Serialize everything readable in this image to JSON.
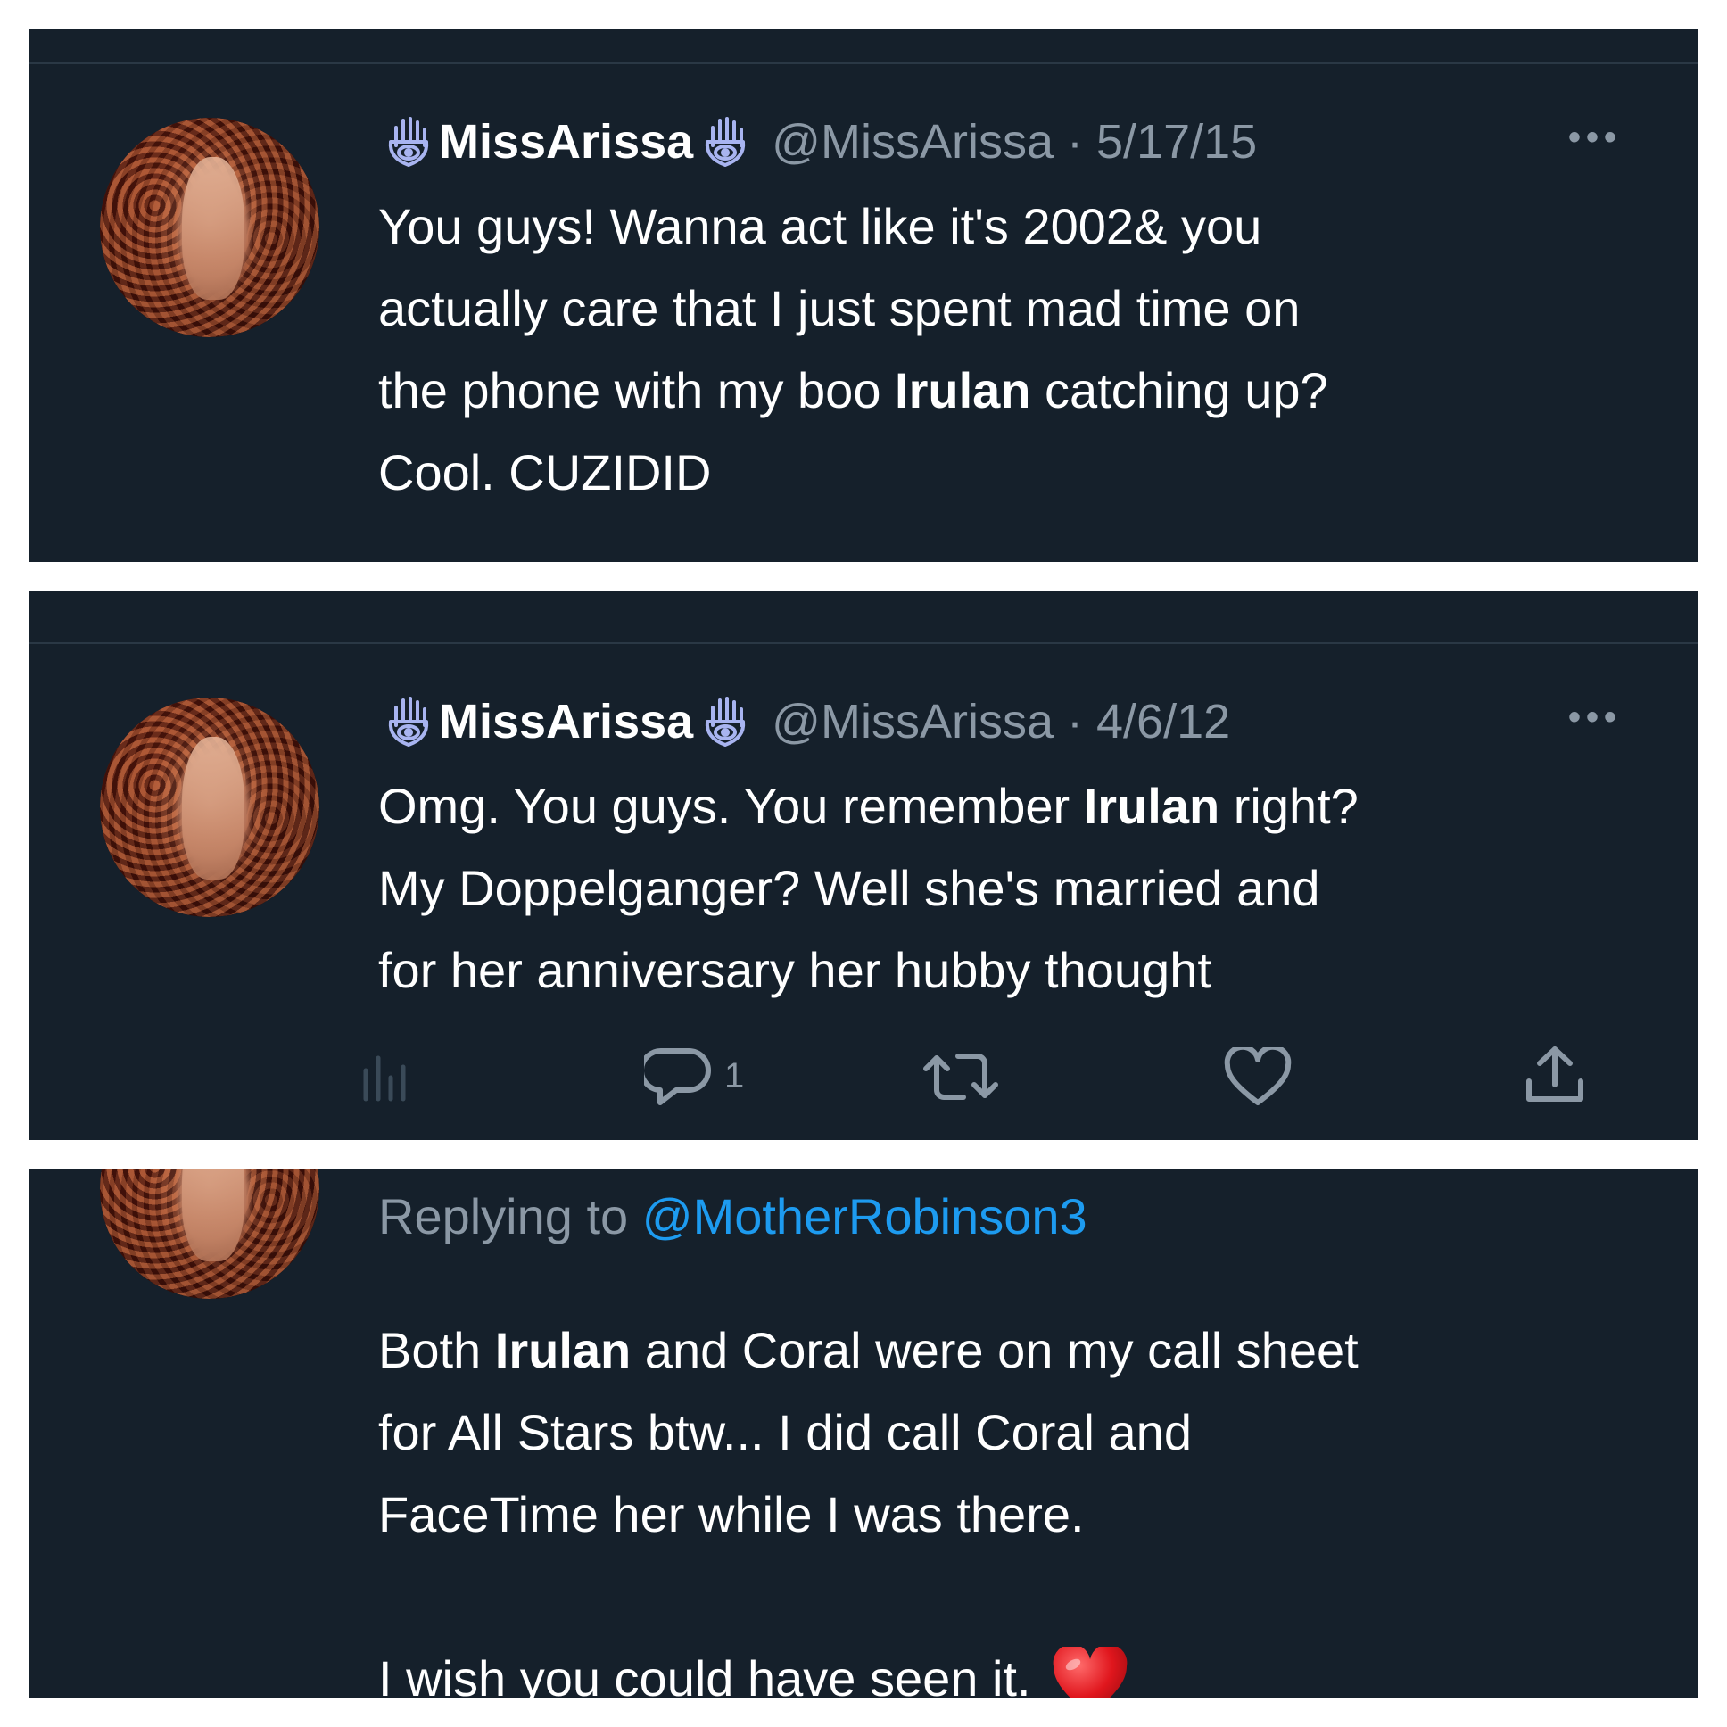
{
  "tweets": [
    {
      "display_name": "MissArissa",
      "handle": "@MissArissa",
      "date": "5/17/15",
      "lines": [
        {
          "pre": "You guys! Wanna act like it's 2002& you",
          "bold": "",
          "post": ""
        },
        {
          "pre": "actually care that I just spent mad time on",
          "bold": "",
          "post": ""
        },
        {
          "pre": "the phone with my boo ",
          "bold": "Irulan",
          "post": " catching up?"
        },
        {
          "pre": "Cool. CUZIDID",
          "bold": "",
          "post": ""
        }
      ]
    },
    {
      "display_name": "MissArissa",
      "handle": "@MissArissa",
      "date": "4/6/12",
      "lines": [
        {
          "pre": "Omg. You guys. You remember ",
          "bold": "Irulan",
          "post": " right?"
        },
        {
          "pre": "My Doppelganger? Well she's married and",
          "bold": "",
          "post": ""
        },
        {
          "pre": "for her anniversary her hubby thought",
          "bold": "",
          "post": ""
        }
      ],
      "actions": {
        "views_icon": "bar-chart-icon",
        "reply_icon": "reply-bubble-icon",
        "reply_count": "1",
        "retweet_icon": "retweet-icon",
        "like_icon": "heart-outline-icon",
        "share_icon": "share-icon"
      }
    },
    {
      "replying_to_label": "Replying to ",
      "replying_to_handle": "@MotherRobinson3",
      "lines": [
        {
          "pre": "Both ",
          "bold": "Irulan",
          "post": " and Coral were on my call sheet"
        },
        {
          "pre": "for All Stars btw... I did call Coral and",
          "bold": "",
          "post": ""
        },
        {
          "pre": "FaceTime her while I was there.",
          "bold": "",
          "post": ""
        }
      ],
      "final_line": "I wish you could have seen it. ",
      "emoji_icon": "red-heart-emoji-icon"
    }
  ],
  "colors": {
    "background": "#15202b",
    "text": "#ffffff",
    "secondary": "#8b98a5",
    "link": "#1d9bf0",
    "hamsa": "#a8b4f0"
  }
}
